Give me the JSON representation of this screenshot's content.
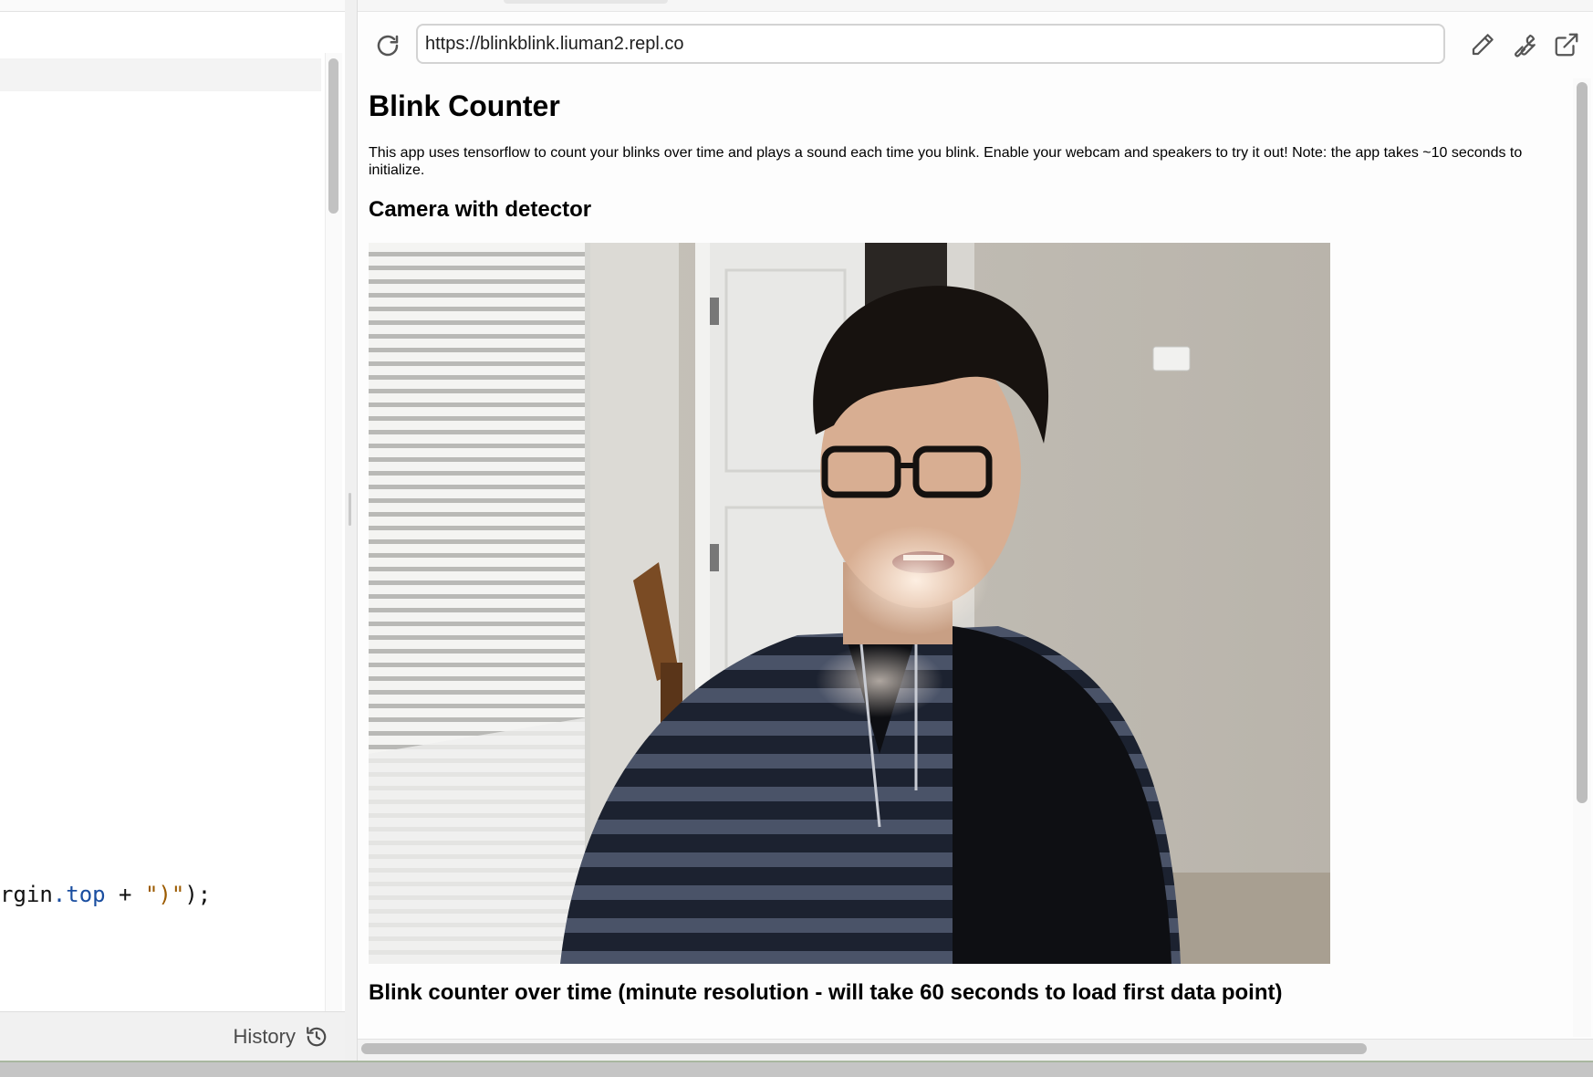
{
  "editor": {
    "code_line": {
      "part1": "rgin",
      "part2": ".top",
      "part3": " + ",
      "part4": "\")\"",
      "part5": ");"
    },
    "footer": {
      "history_label": "History",
      "history_icon": "history-icon"
    }
  },
  "webview": {
    "toolbar": {
      "reload_icon": "reload-icon",
      "url": "https://blinkblink.liuman2.repl.co",
      "edit_icon": "pencil-icon",
      "devtools_icon": "wrench-icon",
      "open_new_tab_icon": "external-link-icon"
    },
    "page": {
      "title": "Blink Counter",
      "description": "This app uses tensorflow to count your blinks over time and plays a sound each time you blink. Enable your webcam and speakers to try it out! Note: the app takes ~10 seconds to initialize.",
      "camera_heading": "Camera with detector",
      "chart_heading": "Blink counter over time (minute resolution - will take 60 seconds to load first data point)"
    }
  }
}
